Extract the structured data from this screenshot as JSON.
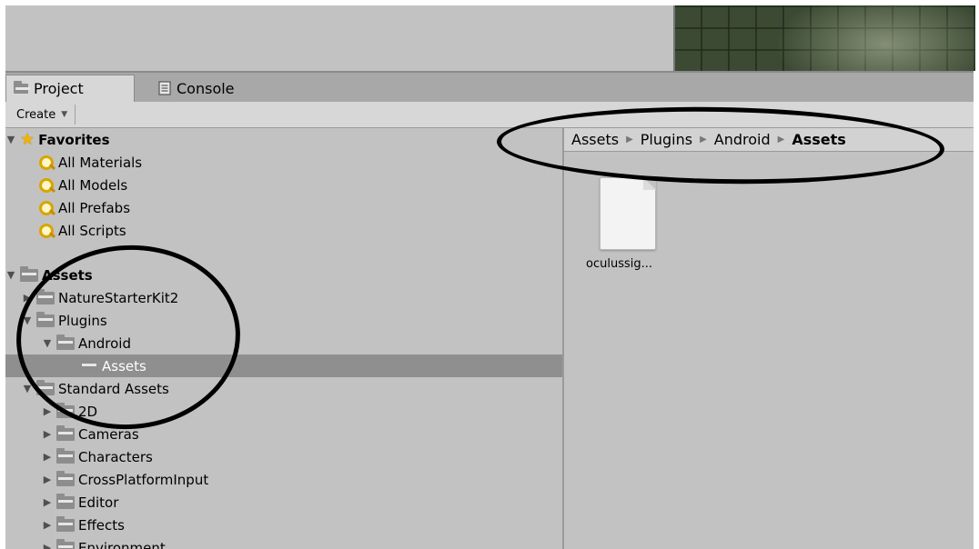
{
  "tabs": {
    "project": "Project",
    "console": "Console"
  },
  "toolbar": {
    "create": "Create"
  },
  "breadcrumb": [
    "Assets",
    "Plugins",
    "Android",
    "Assets"
  ],
  "favorites": {
    "label": "Favorites",
    "items": [
      "All Materials",
      "All Models",
      "All Prefabs",
      "All Scripts"
    ]
  },
  "tree": {
    "root": "Assets",
    "items": [
      "NatureStarterKit2",
      "Plugins",
      "Android",
      "Assets",
      "Standard Assets",
      "2D",
      "Cameras",
      "Characters",
      "CrossPlatformInput",
      "Editor",
      "Effects",
      "Environment"
    ]
  },
  "assets": [
    {
      "name": "oculussig..."
    }
  ],
  "icons": {
    "project_tab": "folder-icon",
    "console_tab": "console-icon",
    "favorites": "star-icon",
    "search": "search-icon",
    "folder": "folder-icon",
    "file": "file-icon"
  }
}
